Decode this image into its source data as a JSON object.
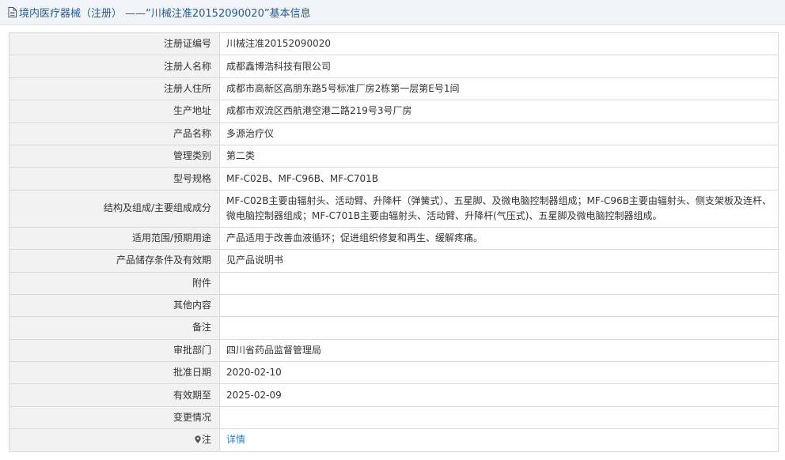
{
  "header": {
    "title": "境内医疗器械（注册） ——“川械注准20152090020”基本信息"
  },
  "colors": {
    "header_bg": "#f0f4f8",
    "title_text": "#2a5a8c",
    "label_bg": "#f2f2f2",
    "border": "#d9d9d9",
    "link": "#2e7bc4"
  },
  "rows": [
    {
      "label": "注册证编号",
      "value": "川械注准20152090020"
    },
    {
      "label": "注册人名称",
      "value": "成都鑫博浩科技有限公司"
    },
    {
      "label": "注册人住所",
      "value": "成都市高新区高朋东路5号标准厂房2栋第一层第E号1间"
    },
    {
      "label": "生产地址",
      "value": "成都市双流区西航港空港二路219号3号厂房"
    },
    {
      "label": "产品名称",
      "value": "多源治疗仪"
    },
    {
      "label": "管理类别",
      "value": "第二类"
    },
    {
      "label": "型号规格",
      "value": "MF-C02B、MF-C96B、MF-C701B"
    },
    {
      "label": "结构及组成/主要组成成分",
      "value": "MF-C02B主要由辐射头、活动臂、升降杆（弹簧式）、五星脚、及微电脑控制器组成；MF-C96B主要由辐射头、侧支架板及连杆、微电脑控制器组成；MF-C701B主要由辐射头、活动臂、升降杆(气压式)、五星脚及微电脑控制器组成。"
    },
    {
      "label": "适用范围/预期用途",
      "value": "产品适用于改善血液循环；促进组织修复和再生、缓解疼痛。"
    },
    {
      "label": "产品储存条件及有效期",
      "value": "见产品说明书"
    },
    {
      "label": "附件",
      "value": ""
    },
    {
      "label": "其他内容",
      "value": ""
    },
    {
      "label": "备注",
      "value": ""
    },
    {
      "label": "审批部门",
      "value": "四川省药品监督管理局"
    },
    {
      "label": "批准日期",
      "value": "2020-02-10"
    },
    {
      "label": "有效期至",
      "value": "2025-02-09"
    },
    {
      "label": "变更情况",
      "value": ""
    },
    {
      "label": "注",
      "value": "详情"
    }
  ]
}
